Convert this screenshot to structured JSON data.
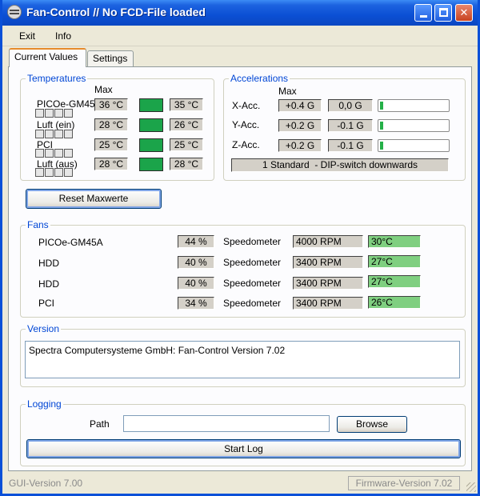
{
  "window": {
    "title": "Fan-Control // No FCD-File loaded",
    "minimize_icon": "minimize-icon",
    "maximize_icon": "maximize-icon",
    "close_icon": "close-icon",
    "close_glyph": "✕"
  },
  "menu": {
    "items": [
      "Exit",
      "Info"
    ]
  },
  "tabs": [
    "Current Values",
    "Settings"
  ],
  "temperatures": {
    "title": "Temperatures",
    "max_label": "Max",
    "rows": [
      {
        "label": "PICOe-GM45",
        "max": "36 °C",
        "current": "35 °C"
      },
      {
        "label": "Luft (ein)",
        "max": "28 °C",
        "current": "26 °C"
      },
      {
        "label": "PCI",
        "max": "25 °C",
        "current": "25 °C"
      },
      {
        "label": "Luft (aus)",
        "max": "28 °C",
        "current": "28 °C"
      }
    ],
    "indicator_color": "#1ba44a"
  },
  "accelerations": {
    "title": "Accelerations",
    "max_label": "Max",
    "rows": [
      {
        "label": "X-Acc.",
        "max": "+0.4 G",
        "current": "0,0 G",
        "level": 0.05
      },
      {
        "label": "Y-Acc.",
        "max": "+0.2 G",
        "current": "-0.1 G",
        "level": 0.05
      },
      {
        "label": "Z-Acc.",
        "max": "+0.2 G",
        "current": "-0.1 G",
        "level": 0.05
      }
    ],
    "status": "1 Standard  - DIP-switch downwards"
  },
  "reset_button": "Reset Maxwerte",
  "fans": {
    "title": "Fans",
    "speedometer_label": "Speedometer",
    "rows": [
      {
        "label": "PICOe-GM45A",
        "percent": "44 %",
        "rpm": "4000 RPM",
        "temp": "30°C"
      },
      {
        "label": "HDD",
        "percent": "40 %",
        "rpm": "3400 RPM",
        "temp": "27°C"
      },
      {
        "label": "HDD",
        "percent": "40 %",
        "rpm": "3400 RPM",
        "temp": "27°C"
      },
      {
        "label": "PCI",
        "percent": "34 %",
        "rpm": "3400 RPM",
        "temp": "26°C"
      }
    ],
    "temp_color": "#7fcf80"
  },
  "version": {
    "title": "Version",
    "text": "Spectra Computersysteme GmbH: Fan-Control Version 7.02"
  },
  "logging": {
    "title": "Logging",
    "path_label": "Path",
    "path_value": "",
    "browse_button": "Browse",
    "start_button": "Start Log"
  },
  "statusbar": {
    "gui_version": "GUI-Version  7.00",
    "firmware_version": "Firmware-Version 7.02"
  },
  "colors": {
    "titlebar": "#0b4fd4",
    "group_title": "#0046d5",
    "tab_accent": "#e68b2c"
  }
}
